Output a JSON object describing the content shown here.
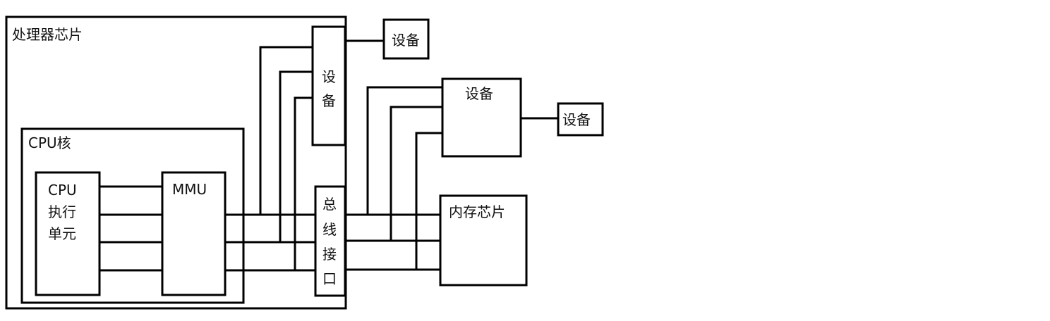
{
  "diagram": {
    "processor_chip": "处理器芯片",
    "cpu_core": "CPU核",
    "cpu_exec_unit": [
      "CPU",
      "执行",
      "单元"
    ],
    "mmu": "MMU",
    "onchip_device": [
      "设",
      "备"
    ],
    "bus_interface": [
      "总",
      "线",
      "接",
      "口"
    ],
    "device_small_top": "设备",
    "device_mid": "设备",
    "device_small_right": "设备",
    "memory_chip": "内存芯片"
  }
}
